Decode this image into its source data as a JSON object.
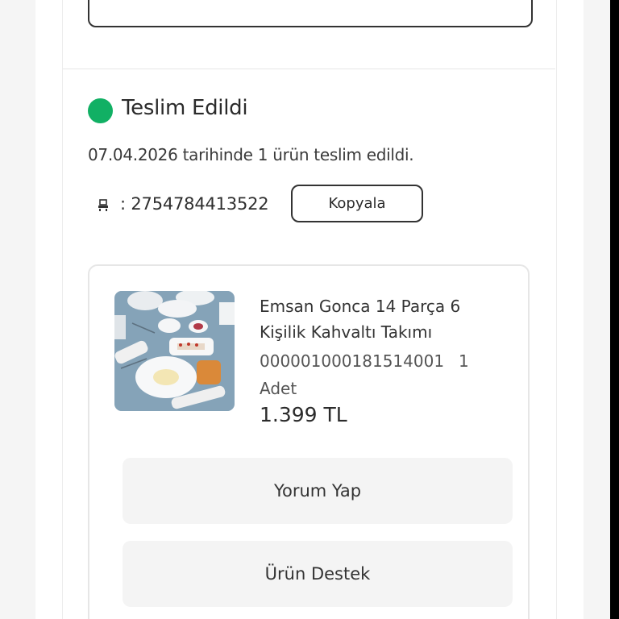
{
  "order": {
    "status": {
      "title": "Teslim Edildi",
      "color": "#11b064",
      "description": "07.04.2026 tarihinde 1 ürün teslim edildi."
    },
    "tracking": {
      "icon": "cargo-icon",
      "prefix": ":",
      "number": "2754784413522",
      "copy_label": "Kopyala"
    },
    "product": {
      "image": "breakfast-set-image",
      "name": "Emsan Gonca 14 Parça 6 Kişilik Kahvaltı Takımı",
      "sku": "000001000181514001",
      "quantity": "1 Adet",
      "price": "1.399 TL"
    },
    "actions": {
      "review_label": "Yorum Yap",
      "support_label": "Ürün Destek"
    }
  }
}
